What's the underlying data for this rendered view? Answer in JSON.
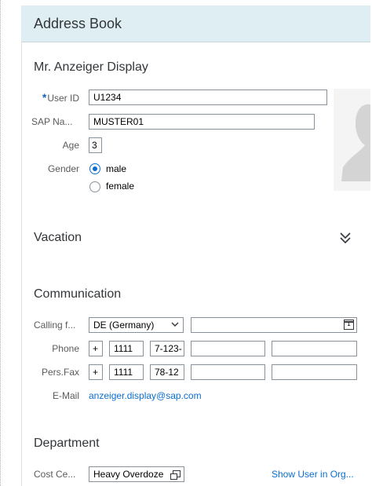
{
  "header": {
    "title": "Address Book"
  },
  "display": {
    "title": "Mr. Anzeiger Display",
    "user_id_label": "User ID",
    "required_mark": "*",
    "user_id_value": "U1234",
    "sap_name_label": "SAP Na...",
    "sap_name_value": "MUSTER01",
    "age_label": "Age",
    "age_value": "3",
    "gender_label": "Gender",
    "gender_options": [
      "male",
      "female"
    ],
    "gender_selected": "male"
  },
  "vacation": {
    "title": "Vacation"
  },
  "communication": {
    "title": "Communication",
    "calling_label": "Calling f...",
    "calling_value": "DE (Germany)",
    "phone_label": "Phone",
    "phone_plus": "+",
    "phone_code": "1111",
    "phone_number": "7-123-",
    "fax_label": "Pers.Fax",
    "fax_plus": "+",
    "fax_code": "1111",
    "fax_number": "78-12",
    "email_label": "E-Mail",
    "email_value": "anzeiger.display@sap.com"
  },
  "department": {
    "title": "Department",
    "cost_center_label": "Cost Ce...",
    "cost_center_value": "Heavy Overdoze",
    "show_user_link": "Show User in Org..."
  },
  "icons": {
    "collapse": "double-chevron-down-icon",
    "calendar": "calendar-icon",
    "value_help": "value-help-icon",
    "dropdown": "chevron-down-icon"
  },
  "colors": {
    "header_bg": "#dfeef2",
    "accent": "#0a6ed1"
  }
}
